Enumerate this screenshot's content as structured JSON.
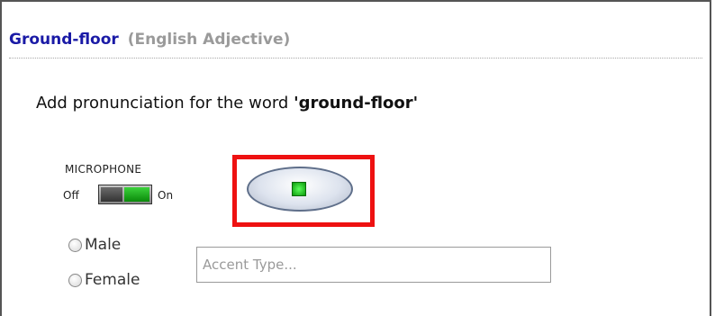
{
  "header": {
    "word": "Ground-floor",
    "part_of_speech": "(English Adjective)"
  },
  "prompt": {
    "prefix": "Add pronunciation for the word ",
    "word": "'ground-floor'"
  },
  "microphone": {
    "label": "MICROPHONE",
    "off_label": "Off",
    "on_label": "On",
    "state": "on"
  },
  "gender": {
    "options": [
      "Male",
      "Female"
    ]
  },
  "accent": {
    "placeholder": "Accent Type...",
    "value": ""
  },
  "colors": {
    "highlight": "#ee1111",
    "word_link": "#1a1aa6",
    "indicator": "#1fbf1f"
  }
}
